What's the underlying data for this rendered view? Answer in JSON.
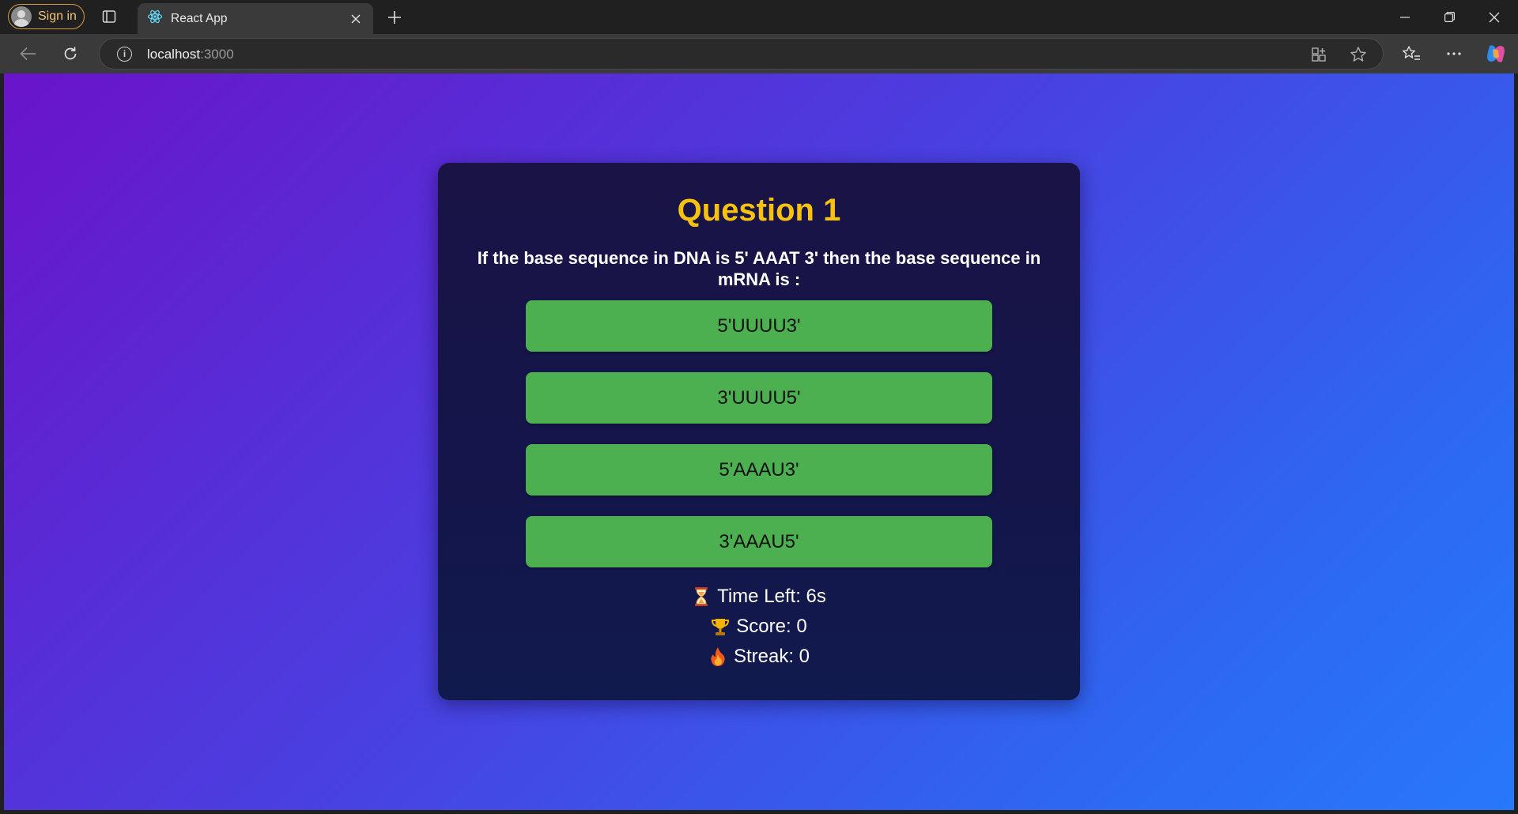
{
  "browser": {
    "signin_label": "Sign in",
    "tab_title": "React App",
    "url_host": "localhost",
    "url_port": ":3000"
  },
  "quiz": {
    "title": "Question 1",
    "question": "If the base sequence in DNA is 5' AAAT 3' then the base sequence in mRNA is :",
    "options": [
      "5'UUUU3'",
      "3'UUUU5'",
      "5'AAAU3'",
      "3'AAAU5'"
    ],
    "time_left": "Time Left: 6s",
    "score": "Score: 0",
    "streak": "Streak: 0"
  },
  "icons": {
    "timer": "hourglass-icon",
    "score": "trophy-icon",
    "streak": "fire-icon"
  },
  "colors": {
    "option_bg": "#4caf50",
    "title": "#f7c20f",
    "card_bg": "#15154a"
  }
}
